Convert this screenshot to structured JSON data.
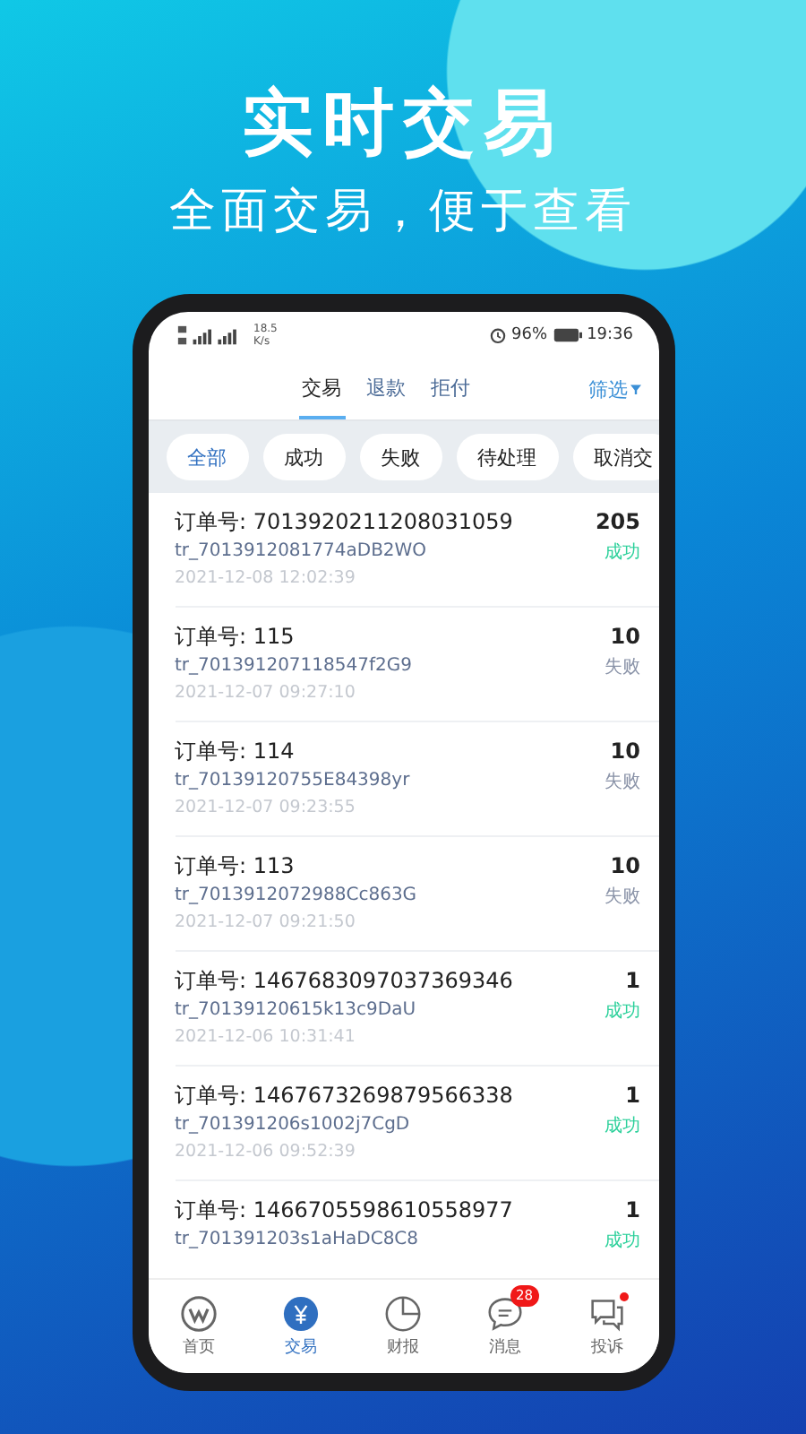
{
  "headline": "实时交易",
  "subheadline": "全面交易，便于查看",
  "status_bar": {
    "speed": "18.5",
    "speed_unit": "K/s",
    "battery": "96%",
    "time": "19:36"
  },
  "tabs": [
    {
      "label": "交易",
      "selected": true
    },
    {
      "label": "退款",
      "selected": false
    },
    {
      "label": "拒付",
      "selected": false
    }
  ],
  "filter": "筛选",
  "chips": [
    {
      "label": "全部",
      "selected": true
    },
    {
      "label": "成功",
      "selected": false
    },
    {
      "label": "失败",
      "selected": false
    },
    {
      "label": "待处理",
      "selected": false
    },
    {
      "label": "取消交",
      "selected": false
    }
  ],
  "orders": [
    {
      "order": "订单号: 7013920211208031059",
      "trade_no": "tr_7013912081774aDB2WO",
      "date": "2021-12-08 12:02:39",
      "amount": "205",
      "status": "成功",
      "color": "#2bd09a"
    },
    {
      "order": "订单号: 115",
      "trade_no": "tr_701391207118547f2G9",
      "date": "2021-12-07 09:27:10",
      "amount": "10",
      "status": "失败",
      "color": "#8a93a8"
    },
    {
      "order": "订单号: 114",
      "trade_no": "tr_70139120755E84398yr",
      "date": "2021-12-07 09:23:55",
      "amount": "10",
      "status": "失败",
      "color": "#8a93a8"
    },
    {
      "order": "订单号: 113",
      "trade_no": "tr_7013912072988Cc863G",
      "date": "2021-12-07 09:21:50",
      "amount": "10",
      "status": "失败",
      "color": "#8a93a8"
    },
    {
      "order": "订单号: 1467683097037369346",
      "trade_no": "tr_70139120615k13c9DaU",
      "date": "2021-12-06 10:31:41",
      "amount": "1",
      "status": "成功",
      "color": "#2bd09a"
    },
    {
      "order": "订单号: 1467673269879566338",
      "trade_no": "tr_701391206s1002j7CgD",
      "date": "2021-12-06 09:52:39",
      "amount": "1",
      "status": "成功",
      "color": "#2bd09a"
    },
    {
      "order": "订单号: 1466705598610558977",
      "trade_no": "tr_701391203s1aHaDC8C8",
      "amount": "1",
      "status": "成功",
      "color": "#2bd09a"
    }
  ],
  "nav": [
    {
      "kind": "home",
      "label": "首页",
      "selected": false
    },
    {
      "kind": "trade",
      "label": "交易",
      "selected": true
    },
    {
      "kind": "report",
      "label": "财报",
      "selected": false
    },
    {
      "kind": "message",
      "label": "消息",
      "selected": false,
      "badge": "28"
    },
    {
      "kind": "complaint",
      "label": "投诉",
      "selected": false,
      "dot": true
    }
  ]
}
